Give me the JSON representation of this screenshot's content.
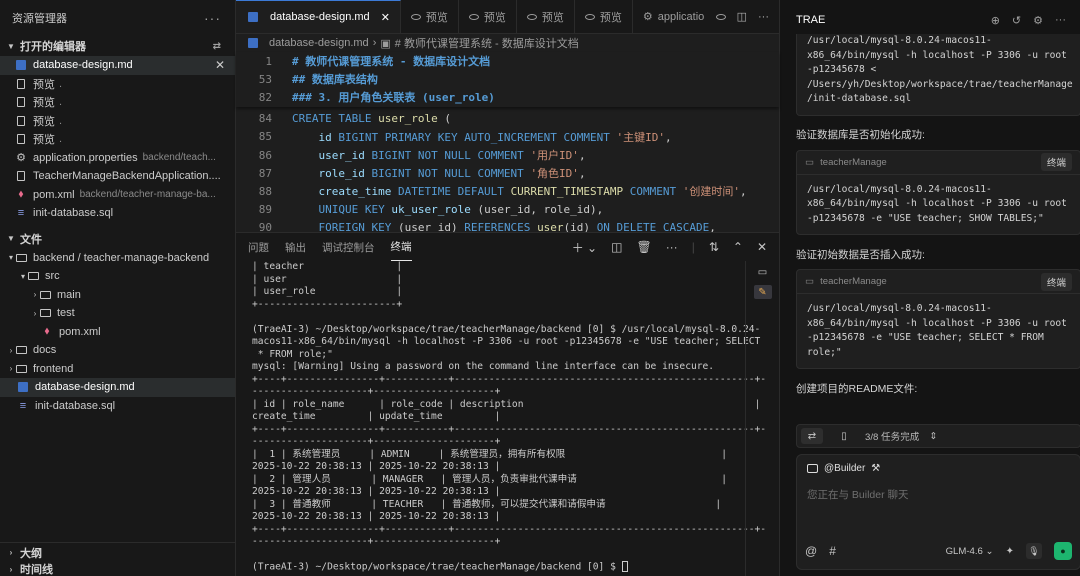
{
  "explorer": {
    "title": "资源管理器",
    "open_editors_label": "打开的编辑器",
    "open_editors": [
      {
        "name": "database-design.md",
        "sub": ""
      },
      {
        "name": "预览",
        "sub": ""
      },
      {
        "name": "预览",
        "sub": ""
      },
      {
        "name": "预览",
        "sub": ""
      },
      {
        "name": "预览",
        "sub": ""
      },
      {
        "name": "application.properties",
        "sub": "backend/teach..."
      },
      {
        "name": "TeacherManageBackendApplication....",
        "sub": ""
      },
      {
        "name": "pom.xml",
        "sub": "backend/teacher-manage-ba..."
      },
      {
        "name": "init-database.sql",
        "sub": ""
      }
    ],
    "files_label": "文件",
    "tree": [
      {
        "name": "backend / teacher-manage-backend"
      },
      {
        "name": "src"
      },
      {
        "name": "main"
      },
      {
        "name": "test"
      },
      {
        "name": "pom.xml"
      },
      {
        "name": "docs"
      },
      {
        "name": "frontend"
      },
      {
        "name": "database-design.md"
      },
      {
        "name": "init-database.sql"
      }
    ],
    "outline_label": "大纲",
    "timeline_label": "时间线"
  },
  "editor": {
    "tabs": [
      {
        "label": "database-design.md"
      },
      {
        "label": "预览"
      },
      {
        "label": "预览"
      },
      {
        "label": "预览"
      },
      {
        "label": "预览"
      },
      {
        "label": "applicatio"
      }
    ],
    "breadcrumb": [
      "database-design.md",
      "# 教师代课管理系统 - 数据库设计文档"
    ],
    "sticky_lines": [
      {
        "num": "1",
        "text": "# 教师代课管理系统 - 数据库设计文档"
      },
      {
        "num": "53",
        "text": "## 数据库表结构"
      },
      {
        "num": "82",
        "text": "### 3. 用户角色关联表 (user_role)"
      }
    ],
    "lines": [
      {
        "num": "84",
        "parts": [
          {
            "t": "CREATE TABLE ",
            "c": "kw"
          },
          {
            "t": "user_role",
            "c": "fn"
          },
          {
            "t": " (",
            "c": ""
          }
        ]
      },
      {
        "num": "85",
        "parts": [
          {
            "t": "    id ",
            "c": "id"
          },
          {
            "t": "BIGINT PRIMARY KEY AUTO_INCREMENT COMMENT ",
            "c": "kw"
          },
          {
            "t": "'主键ID'",
            "c": "str"
          },
          {
            "t": ",",
            "c": ""
          }
        ]
      },
      {
        "num": "86",
        "parts": [
          {
            "t": "    user_id ",
            "c": "id"
          },
          {
            "t": "BIGINT NOT NULL COMMENT ",
            "c": "kw"
          },
          {
            "t": "'用户ID'",
            "c": "str"
          },
          {
            "t": ",",
            "c": ""
          }
        ]
      },
      {
        "num": "87",
        "parts": [
          {
            "t": "    role_id ",
            "c": "id"
          },
          {
            "t": "BIGINT NOT NULL COMMENT ",
            "c": "kw"
          },
          {
            "t": "'角色ID'",
            "c": "str"
          },
          {
            "t": ",",
            "c": ""
          }
        ]
      },
      {
        "num": "88",
        "parts": [
          {
            "t": "    create_time ",
            "c": "id"
          },
          {
            "t": "DATETIME DEFAULT ",
            "c": "kw"
          },
          {
            "t": "CURRENT_TIMESTAMP",
            "c": "fn"
          },
          {
            "t": " COMMENT ",
            "c": "kw"
          },
          {
            "t": "'创建时间'",
            "c": "str"
          },
          {
            "t": ",",
            "c": ""
          }
        ]
      },
      {
        "num": "89",
        "parts": [
          {
            "t": "    UNIQUE KEY ",
            "c": "kw"
          },
          {
            "t": "uk_user_role",
            "c": "id"
          },
          {
            "t": " (user_id, role_id),",
            "c": ""
          }
        ]
      },
      {
        "num": "90",
        "parts": [
          {
            "t": "    FOREIGN KEY ",
            "c": "kw"
          },
          {
            "t": "(user_id) ",
            "c": ""
          },
          {
            "t": "REFERENCES ",
            "c": "kw"
          },
          {
            "t": "user",
            "c": "fn"
          },
          {
            "t": "(id) ",
            "c": ""
          },
          {
            "t": "ON DELETE CASCADE",
            "c": "kw"
          },
          {
            "t": ",",
            "c": ""
          }
        ]
      }
    ]
  },
  "panel": {
    "tabs": [
      "问题",
      "输出",
      "调试控制台",
      "终端"
    ],
    "active_tab": "终端",
    "terminal_lines": [
      "| teacher                |",
      "| user                   |",
      "| user_role              |",
      "+------------------------+",
      "",
      "(TraeAI-3) ~/Desktop/workspace/trae/teacherManage/backend [0] $ /usr/local/mysql-8.0.24-",
      "macos11-x86_64/bin/mysql -h localhost -P 3306 -u root -p12345678 -e \"USE teacher; SELECT",
      " * FROM role;\"",
      "mysql: [Warning] Using a password on the command line interface can be insecure.",
      "+----+----------------+-----------+----------------------------------------------------+-",
      "--------------------+---------------------+",
      "| id | role_name      | role_code | description                                        |",
      "create_time         | update_time         |",
      "+----+----------------+-----------+----------------------------------------------------+-",
      "--------------------+---------------------+",
      "|  1 | 系统管理员     | ADMIN     | 系统管理员，拥有所有权限                           |",
      "2025-10-22 20:38:13 | 2025-10-22 20:38:13 |",
      "|  2 | 管理人员       | MANAGER   | 管理人员，负责审批代课申请                         |",
      "2025-10-22 20:38:13 | 2025-10-22 20:38:13 |",
      "|  3 | 普通教师       | TEACHER   | 普通教师，可以提交代课和请假申请                   |",
      "2025-10-22 20:38:13 | 2025-10-22 20:38:13 |",
      "+----+----------------+-----------+----------------------------------------------------+-",
      "--------------------+---------------------+",
      "",
      "(TraeAI-3) ~/Desktop/workspace/trae/teacherManage/backend [0] $ "
    ]
  },
  "ai": {
    "title": "TRAE",
    "top_command": "/usr/local/mysql-8.0.24-macos11-\nx86_64/bin/mysql -h localhost -P 3306 -u root\n-p12345678 <\n/Users/yh/Desktop/workspace/trae/teacherManage\n/init-database.sql",
    "messages": [
      {
        "text": "验证数据库是否初始化成功:",
        "box_title": "teacherManage",
        "run_label": "终端",
        "command": "/usr/local/mysql-8.0.24-macos11-\nx86_64/bin/mysql -h localhost -P 3306 -u root\n-p12345678 -e \"USE teacher; SHOW TABLES;\""
      },
      {
        "text": "验证初始数据是否插入成功:",
        "box_title": "teacherManage",
        "run_label": "终端",
        "command": "/usr/local/mysql-8.0.24-macos11-\nx86_64/bin/mysql -h localhost -P 3306 -u root\n-p12345678 -e \"USE teacher; SELECT * FROM\nrole;\""
      }
    ],
    "final_text": "创建项目的README文件:",
    "task_progress": "3/8 任务完成",
    "input": {
      "agent": "@Builder",
      "placeholder": "您正在与 Builder 聊天",
      "model": "GLM-4.6"
    }
  }
}
